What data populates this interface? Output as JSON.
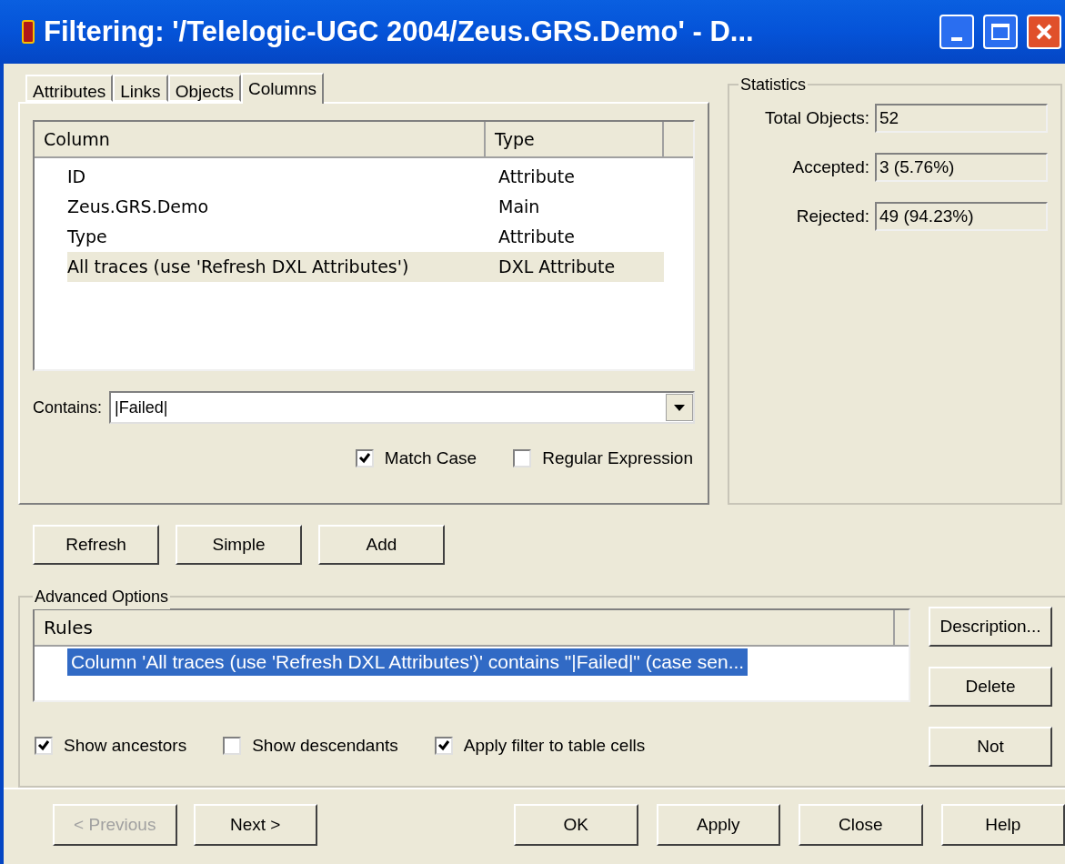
{
  "window": {
    "title": "Filtering: '/Telelogic-UGC 2004/Zeus.GRS.Demo' - D..."
  },
  "tabs": [
    {
      "label": "Attributes",
      "selected": false
    },
    {
      "label": "Links",
      "selected": false
    },
    {
      "label": "Objects",
      "selected": false
    },
    {
      "label": "Columns",
      "selected": true
    }
  ],
  "column_list": {
    "columns": [
      "Column",
      "Type"
    ],
    "rows": [
      {
        "column": "ID",
        "type": "Attribute",
        "selected": false
      },
      {
        "column": "Zeus.GRS.Demo",
        "type": "Main",
        "selected": false
      },
      {
        "column": "Type",
        "type": "Attribute",
        "selected": false
      },
      {
        "column": "All traces (use 'Refresh DXL Attributes')",
        "type": "DXL Attribute",
        "selected": true
      }
    ]
  },
  "contains": {
    "label": "Contains:",
    "value": "|Failed|"
  },
  "match_options": [
    {
      "label": "Match Case",
      "checked": true
    },
    {
      "label": "Regular Expression",
      "checked": false
    }
  ],
  "statistics": {
    "title": "Statistics",
    "fields": [
      {
        "label": "Total Objects:",
        "value": "52"
      },
      {
        "label": "Accepted:",
        "value": "3 (5.76%)"
      },
      {
        "label": "Rejected:",
        "value": "49 (94.23%)"
      }
    ]
  },
  "buttons": [
    "Refresh",
    "Simple",
    "Add"
  ],
  "advanced_options": {
    "title": "Advanced Options",
    "rules_header": "Rules",
    "rules": [
      {
        "text": "Column 'All traces (use 'Refresh DXL Attributes')' contains \"|Failed|\" (case sen...",
        "selected": true
      }
    ],
    "side_buttons": [
      "Description...",
      "Delete",
      "Not"
    ],
    "options": [
      {
        "label": "Show ancestors",
        "checked": true
      },
      {
        "label": "Show descendants",
        "checked": false
      },
      {
        "label": "Apply filter to table cells",
        "checked": true
      }
    ]
  },
  "footer_buttons": [
    {
      "label": "< Previous",
      "disabled": true
    },
    {
      "label": "Next >",
      "disabled": false
    },
    {
      "label": "OK",
      "disabled": false
    },
    {
      "label": "Apply",
      "disabled": false
    },
    {
      "label": "Close",
      "disabled": false
    },
    {
      "label": "Help",
      "disabled": false
    }
  ]
}
